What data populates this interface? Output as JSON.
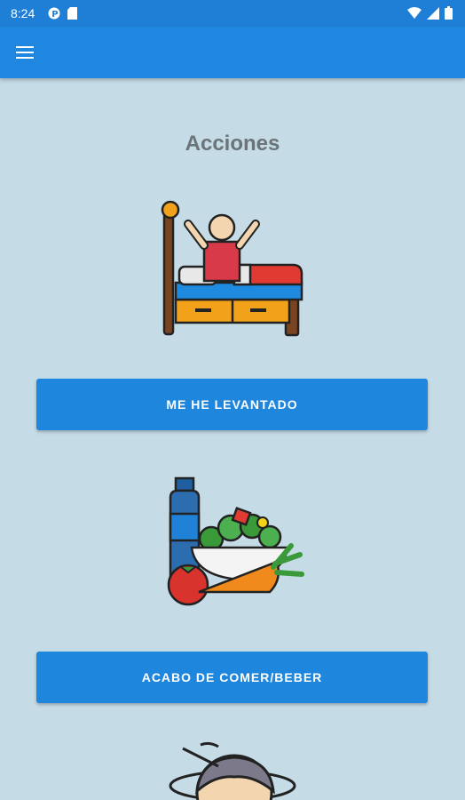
{
  "status_bar": {
    "time": "8:24",
    "left_icons": [
      "p-icon",
      "sd-card-icon"
    ],
    "right_icons": [
      "wifi-icon",
      "signal-icon",
      "battery-icon"
    ]
  },
  "app_bar": {
    "menu_icon": "hamburger-menu-icon"
  },
  "main": {
    "title": "Acciones",
    "actions": [
      {
        "label": "ME HE LEVANTADO",
        "icon": "bed-wake-up-icon"
      },
      {
        "label": "ACABO DE COMER/BEBER",
        "icon": "food-drink-icon"
      },
      {
        "label": "",
        "icon": "sleep-face-icon"
      }
    ]
  },
  "colors": {
    "primary": "#2087e0",
    "background": "#c5dbe6",
    "title_text": "#6b7478",
    "button_text": "#ffffff"
  }
}
